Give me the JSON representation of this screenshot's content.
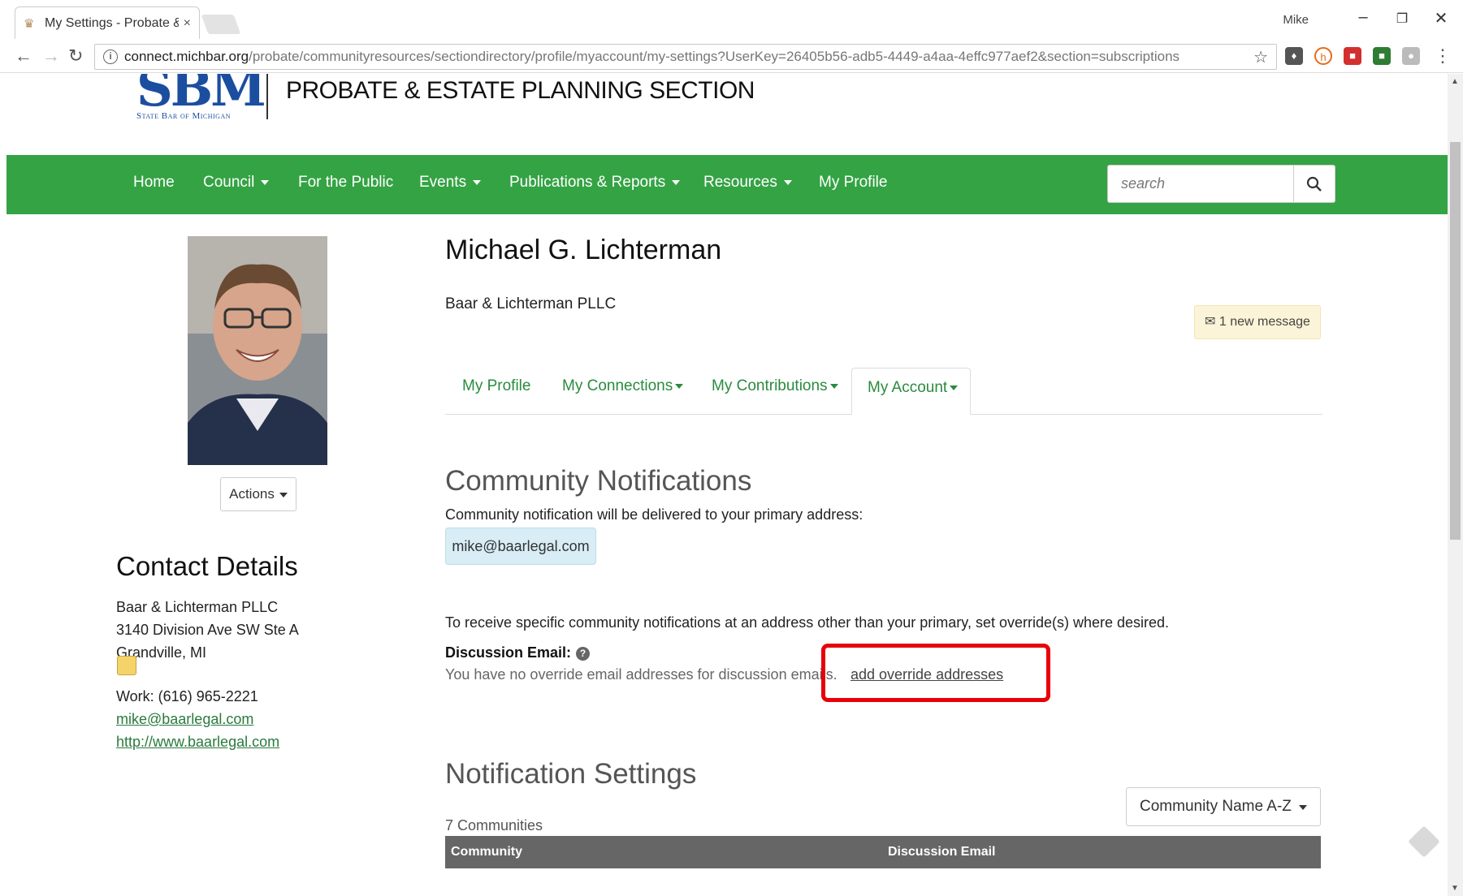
{
  "browser": {
    "tab_title": "My Settings - Probate & I",
    "tab_close": "×",
    "user": "Mike",
    "url_host": "connect.michbar.org",
    "url_path": "/probate/communityresources/sectiondirectory/profile/myaccount/my-settings?UserKey=26405b56-adb5-4449-a4aa-4effc977aef2&section=subscriptions"
  },
  "site": {
    "logo_text": "SBM",
    "logo_subtext": "State Bar of Michigan",
    "section_title": "PROBATE & ESTATE PLANNING SECTION"
  },
  "nav": {
    "items": [
      {
        "label": "Home"
      },
      {
        "label": "Council"
      },
      {
        "label": "For the Public"
      },
      {
        "label": "Events"
      },
      {
        "label": "Publications & Reports"
      },
      {
        "label": "Resources"
      },
      {
        "label": "My Profile"
      }
    ],
    "search_placeholder": "search"
  },
  "sidebar": {
    "actions_label": "Actions",
    "contact_title": "Contact Details",
    "company": "Baar & Lichterman PLLC",
    "address1": "3140 Division Ave SW Ste A",
    "address2": "Grandville, MI",
    "work_phone": "Work: (616) 965-2221",
    "email": "mike@baarlegal.com",
    "website": "http://www.baarlegal.com"
  },
  "profile": {
    "name": "Michael G. Lichterman",
    "company": "Baar & Lichterman PLLC",
    "message_badge": "1 new message",
    "tabs": [
      {
        "label": "My Profile"
      },
      {
        "label": "My Connections"
      },
      {
        "label": "My Contributions"
      },
      {
        "label": "My Account"
      }
    ]
  },
  "notifications": {
    "heading": "Community Notifications",
    "delivery_text": "Community notification will be delivered to your primary address:",
    "primary_email": "mike@baarlegal.com",
    "override_info": "To receive specific community notifications at an address other than your primary, set override(s) where desired.",
    "discussion_label": "Discussion Email:",
    "discussion_text": "You have no override email addresses for discussion emails.",
    "override_link": "add override addresses"
  },
  "settings": {
    "heading": "Notification Settings",
    "count": "7 Communities",
    "sort_value": "Community Name A-Z",
    "columns": [
      "Community",
      "Discussion Email"
    ]
  },
  "colors": {
    "nav_green": "#34a344",
    "link_green": "#2a8b3e",
    "highlight_red": "#e8000a"
  }
}
